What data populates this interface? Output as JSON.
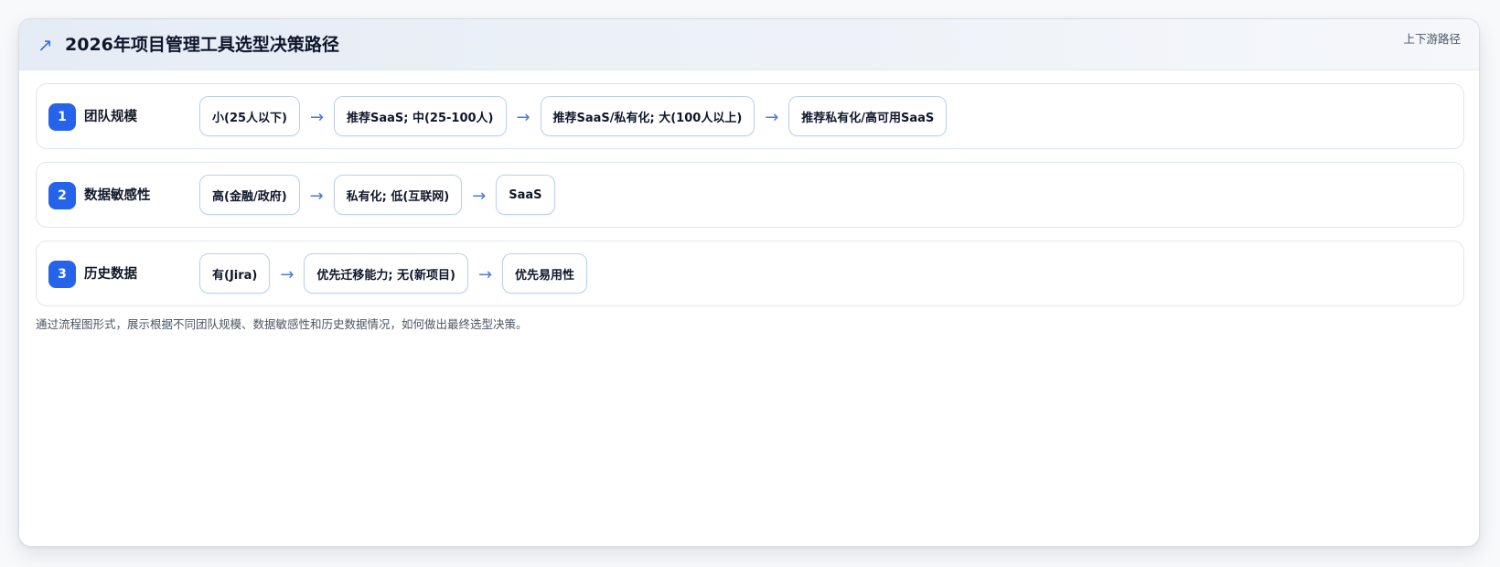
{
  "header": {
    "icon": "trend-arrow-icon",
    "title": "2026年项目管理工具选型决策路径",
    "tag": "上下游路径"
  },
  "rows": [
    {
      "step": "1",
      "label": "团队规模",
      "nodes": [
        "小(25人以下)",
        "推荐SaaS; 中(25-100人)",
        "推荐SaaS/私有化; 大(100人以上)",
        "推荐私有化/高可用SaaS"
      ],
      "arrow": "→"
    },
    {
      "step": "2",
      "label": "数据敏感性",
      "nodes": [
        "高(金融/政府)",
        "私有化; 低(互联网)",
        "SaaS"
      ],
      "arrow": "→"
    },
    {
      "step": "3",
      "label": "历史数据",
      "nodes": [
        "有(Jira)",
        "优先迁移能力; 无(新项目)",
        "优先易用性"
      ],
      "arrow": "→"
    }
  ],
  "caption": "通过流程图形式，展示根据不同团队规模、数据敏感性和历史数据情况，如何做出最终选型决策。",
  "colors": {
    "accent": "#2563eb",
    "arrow": "#4a7bd9",
    "node_border": "#bcd0ee"
  }
}
